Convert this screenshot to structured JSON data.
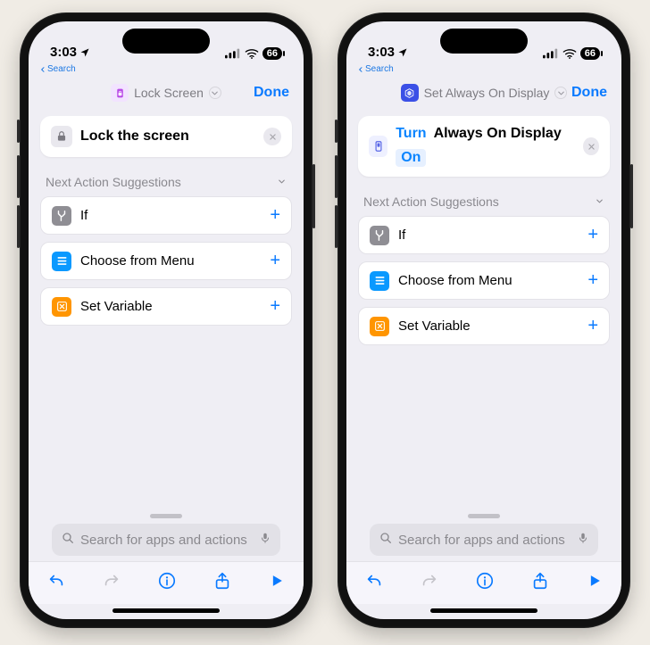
{
  "status": {
    "time": "3:03",
    "breadcrumb": "Search",
    "battery_pct": "66"
  },
  "phones": [
    {
      "header": {
        "title": "Lock Screen",
        "icon_name": "lockscreen-icon",
        "icon_bg": "#f2e3ff",
        "icon_fg": "#b94be7"
      },
      "action": {
        "type": "simple",
        "icon_name": "lock-icon",
        "icon_bg": "#e9e8ee",
        "icon_fg": "#7a7980",
        "text": "Lock the screen"
      }
    },
    {
      "header": {
        "title": "Set Always On Display",
        "icon_name": "shortcuts-icon",
        "icon_bg": "#3b50e6",
        "icon_fg": "#ffffff"
      },
      "action": {
        "type": "tokens",
        "icon_name": "display-icon",
        "icon_bg": "#eef0ff",
        "icon_fg": "#5866e6",
        "verb": "Turn",
        "object": "Always On Display",
        "state": "On"
      }
    }
  ],
  "suggestions_title": "Next Action Suggestions",
  "suggestions": [
    {
      "name": "if",
      "label": "If",
      "icon_bg": "#8f8e94",
      "icon_fg": "#fff",
      "icon_svg": "branch"
    },
    {
      "name": "menu",
      "label": "Choose from Menu",
      "icon_bg": "#0a99ff",
      "icon_fg": "#fff",
      "icon_svg": "list"
    },
    {
      "name": "var",
      "label": "Set Variable",
      "icon_bg": "#ff9500",
      "icon_fg": "#fff",
      "icon_svg": "xbox"
    }
  ],
  "done_label": "Done",
  "search_placeholder": "Search for apps and actions",
  "toolbar": [
    "undo",
    "redo",
    "info",
    "share",
    "play"
  ]
}
